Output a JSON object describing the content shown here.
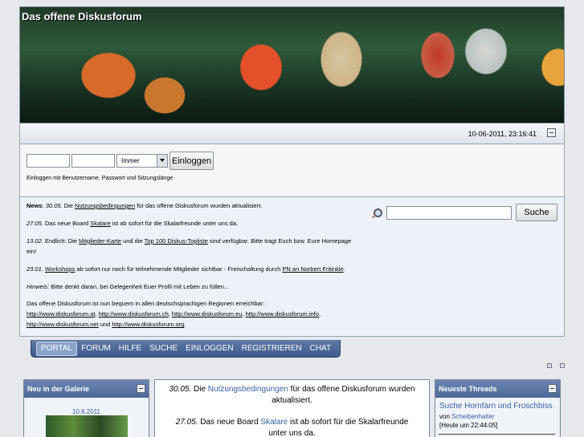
{
  "header": {
    "title": "Das offene Diskusforum"
  },
  "datebar": {
    "datetime": "10-06-2011, 23:16:41"
  },
  "login": {
    "remember_value": "Immer",
    "button_label": "Einloggen",
    "hint": "Einloggen mit Benutzername, Passwort und Sitzungslänge"
  },
  "news": {
    "n1_label": "News",
    "n1_date": "30.05.",
    "n1_pre": " Die ",
    "n1_link": "Nutzungsbedingungen",
    "n1_post": " für das offene Diskusforum wurden aktualisiert.",
    "n2_date": "27.05.",
    "n2_pre": " Das neue Board ",
    "n2_link": "Skalare",
    "n2_post": " ist ab sofort für die Skalarfreunde unter uns da.",
    "n3_date": "13.02.",
    "n3_pre": " Endlich: Die ",
    "n3_link1": "Mitglieder-Karte",
    "n3_mid": " und die ",
    "n3_link2": "Top 100 Diskus-Topliste",
    "n3_post": " sind verfügbar. Bitte tragt Euch bzw. Eure Homepage ein!",
    "n4_date": "23.01.",
    "n4_pre": " ",
    "n4_link1": "Workshops",
    "n4_mid": " ab sofort nur noch für teilnehmende Mitglieder sichtbar - Freischaltung durch ",
    "n4_link2": "PN an Norbert Fritinkle",
    "n4_post": ".",
    "n5_label": "Hinweis:",
    "n5_text": " Bitte denkt daran, bei Gelegenheit Euer Profil mit Leben zu füllen...",
    "n6_text": "Das offene Diskusforum ist nun bequem in allen deutschsprachigen Regionen erreichbar:",
    "urls": {
      "at": "http://www.diskusforum.at",
      "ch": "http://www.diskusforum.ch",
      "eu": "http://www.diskusforum.eu",
      "info": "http://www.diskusforum.info",
      "net": "http://www.diskusforum.net",
      "org": "http://www.diskusforum.org"
    },
    "sep": ", ",
    "und": " und ",
    "end": "."
  },
  "search": {
    "button_label": "Suche"
  },
  "nav": [
    "PORTAL",
    "FORUM",
    "HILFE",
    "SUCHE",
    "EINLOGGEN",
    "REGISTRIEREN",
    "CHAT"
  ],
  "gallery": {
    "title": "Neu in der Galerie",
    "date": "10.6.2011"
  },
  "center": {
    "d1": "30.05.",
    "t1_pre": " Die ",
    "t1_link": "Nutzungsbedingungen",
    "t1_post": " für das offene Diskusforum wurden aktualisiert.",
    "d2": "27.05.",
    "t2_pre": " Das neue Board ",
    "t2_link": "Skalare",
    "t2_post": " ist ab sofort für die Skalarfreunde unter uns da."
  },
  "threads": {
    "title": "Neueste Threads",
    "item_title": "Suche Hornfarn und Froschbiss",
    "by_label": "von ",
    "author": "Scheibenhalter",
    "time": "[Heute um 22:44:05]"
  }
}
